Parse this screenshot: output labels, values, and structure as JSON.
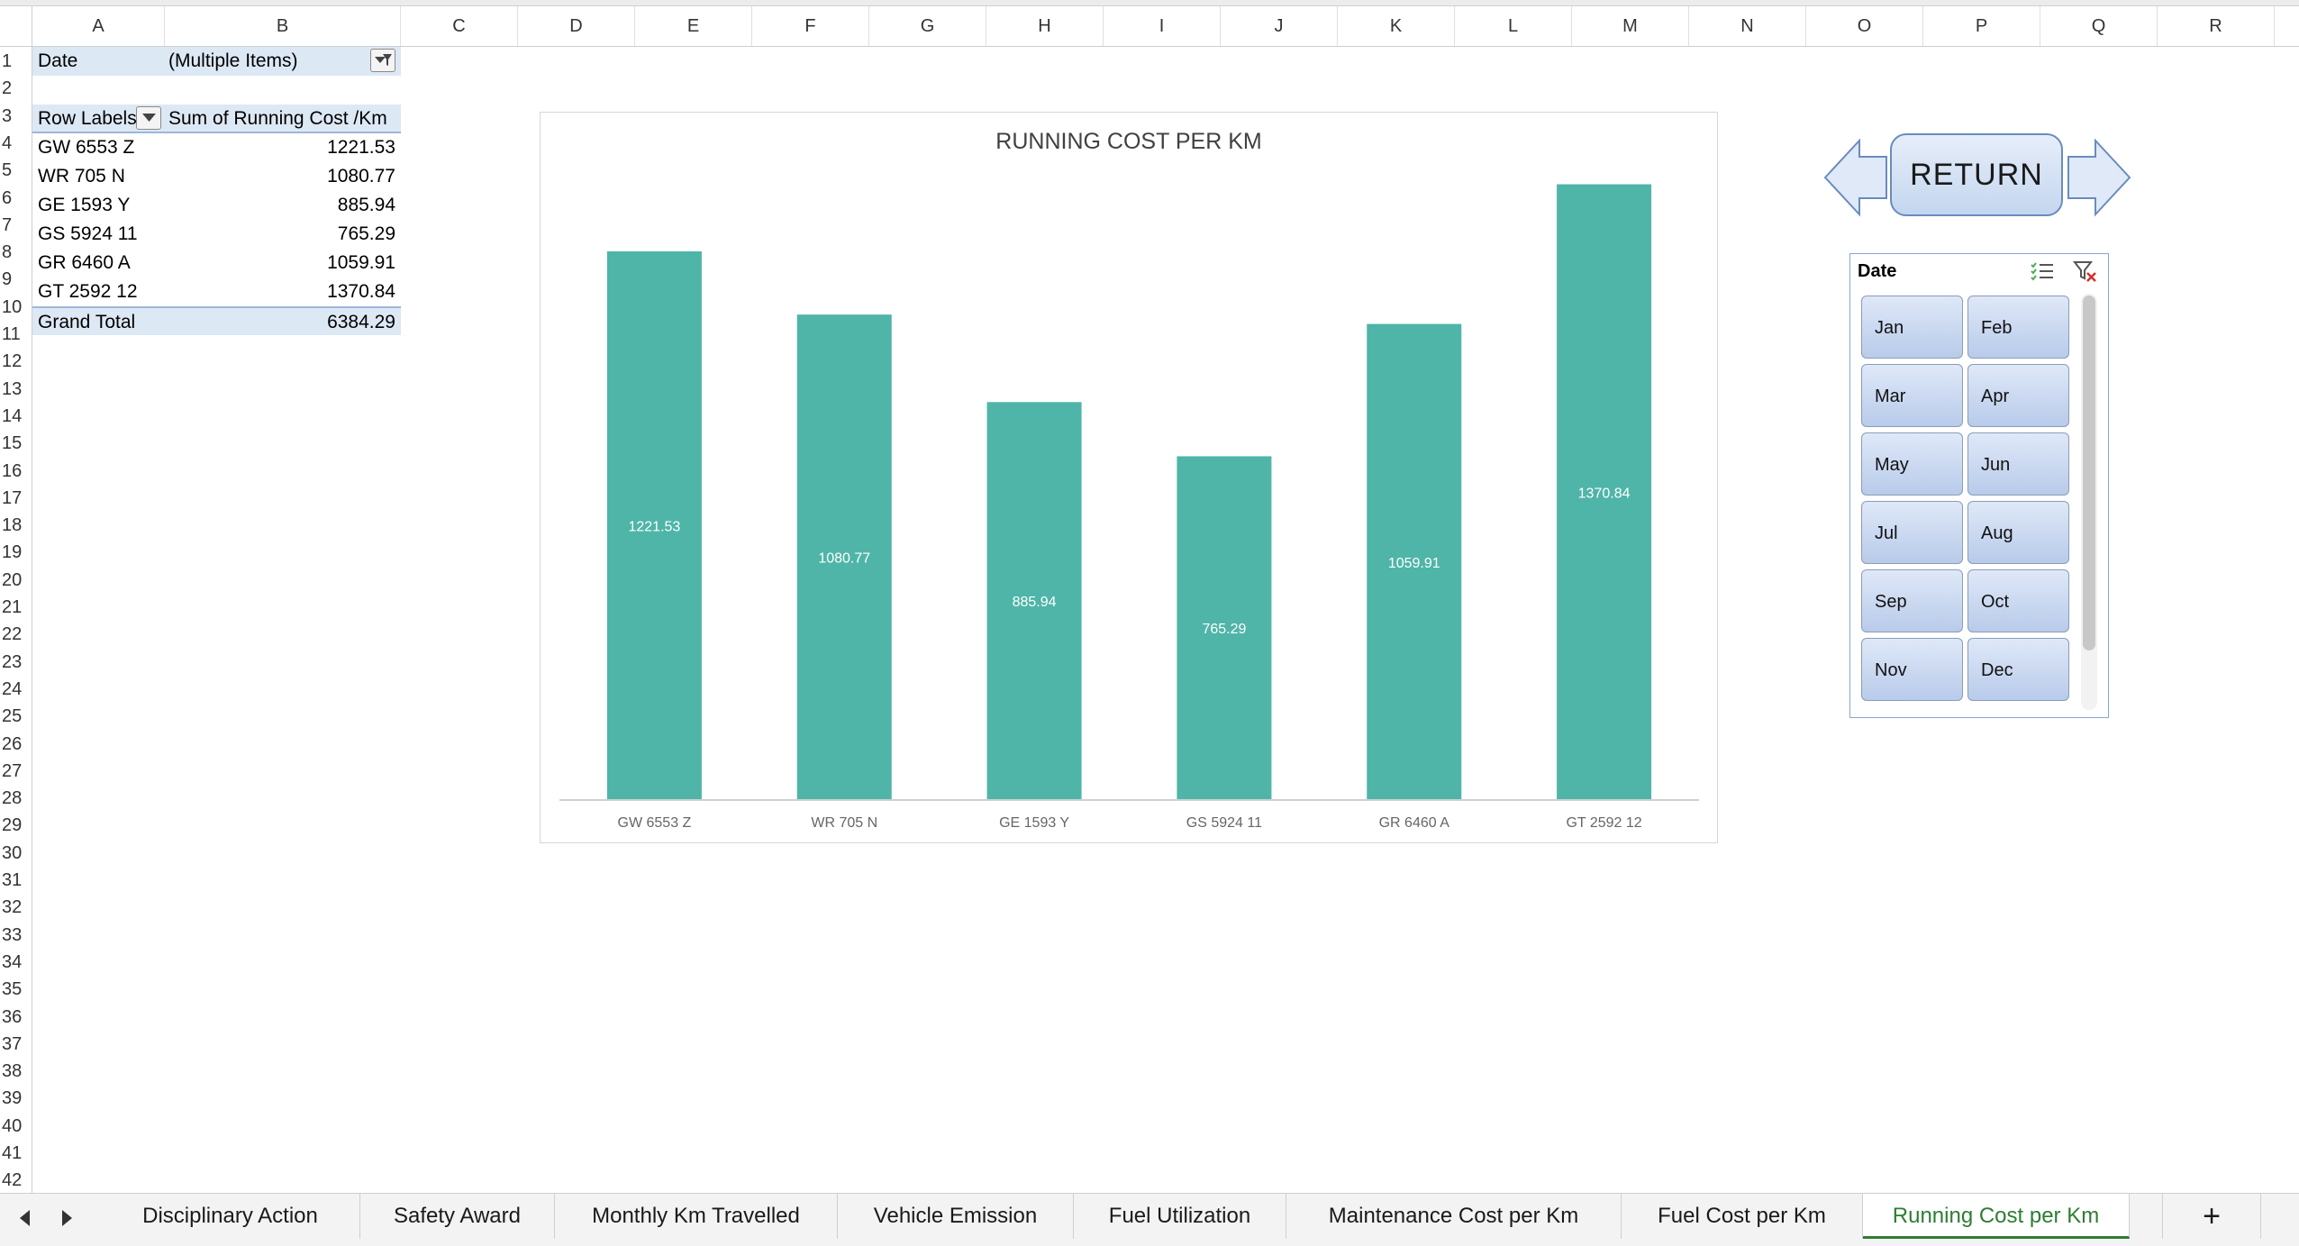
{
  "columns": [
    "A",
    "B",
    "C",
    "D",
    "E",
    "F",
    "G",
    "H",
    "I",
    "J",
    "K",
    "L",
    "M",
    "N",
    "O",
    "P",
    "Q",
    "R"
  ],
  "rows": [
    "1",
    "2",
    "3",
    "4",
    "5",
    "6",
    "7",
    "8",
    "9",
    "10",
    "11",
    "12",
    "13",
    "14",
    "15",
    "16",
    "17",
    "18",
    "19",
    "20",
    "21",
    "22",
    "23",
    "24",
    "25",
    "26",
    "27",
    "28",
    "29",
    "30",
    "31",
    "32",
    "33",
    "34",
    "35",
    "36",
    "37",
    "38",
    "39",
    "40",
    "41",
    "42"
  ],
  "pivot": {
    "filter_label": "Date",
    "filter_value": "(Multiple Items)",
    "row_labels_header": "Row Labels",
    "value_header": "Sum of Running Cost /Km",
    "rows": [
      {
        "label": "GW 6553 Z",
        "value": "1221.53"
      },
      {
        "label": "WR 705 N",
        "value": "1080.77"
      },
      {
        "label": "GE 1593 Y",
        "value": "885.94"
      },
      {
        "label": "GS 5924 11",
        "value": "765.29"
      },
      {
        "label": "GR 6460 A",
        "value": "1059.91"
      },
      {
        "label": "GT 2592 12",
        "value": "1370.84"
      }
    ],
    "total_label": "Grand Total",
    "total_value": "6384.29"
  },
  "chart_data": {
    "type": "bar",
    "title": "RUNNING COST PER KM",
    "categories": [
      "GW 6553 Z",
      "WR 705 N",
      "GE 1593 Y",
      "GS 5924 11",
      "GR 6460 A",
      "GT 2592 12"
    ],
    "values": [
      1221.53,
      1080.77,
      885.94,
      765.29,
      1059.91,
      1370.84
    ],
    "data_labels": [
      "1221.53",
      "1080.77",
      "885.94",
      "765.29",
      "1059.91",
      "1370.84"
    ],
    "ylim": [
      0,
      1400
    ],
    "bar_color": "#4fb5a8",
    "grid": false,
    "legend": "none"
  },
  "return_button": {
    "label": "RETURN"
  },
  "slicer": {
    "title": "Date",
    "items": [
      "Jan",
      "Feb",
      "Mar",
      "Apr",
      "May",
      "Jun",
      "Jul",
      "Aug",
      "Sep",
      "Oct",
      "Nov",
      "Dec"
    ]
  },
  "sheet_tabs": [
    {
      "label": "Disciplinary Action"
    },
    {
      "label": "Safety Award"
    },
    {
      "label": "Monthly Km Travelled"
    },
    {
      "label": "Vehicle Emission"
    },
    {
      "label": "Fuel Utilization"
    },
    {
      "label": "Maintenance Cost per Km"
    },
    {
      "label": "Fuel Cost per Km"
    },
    {
      "label": "Running Cost per Km"
    }
  ],
  "add_sheet_label": "+"
}
